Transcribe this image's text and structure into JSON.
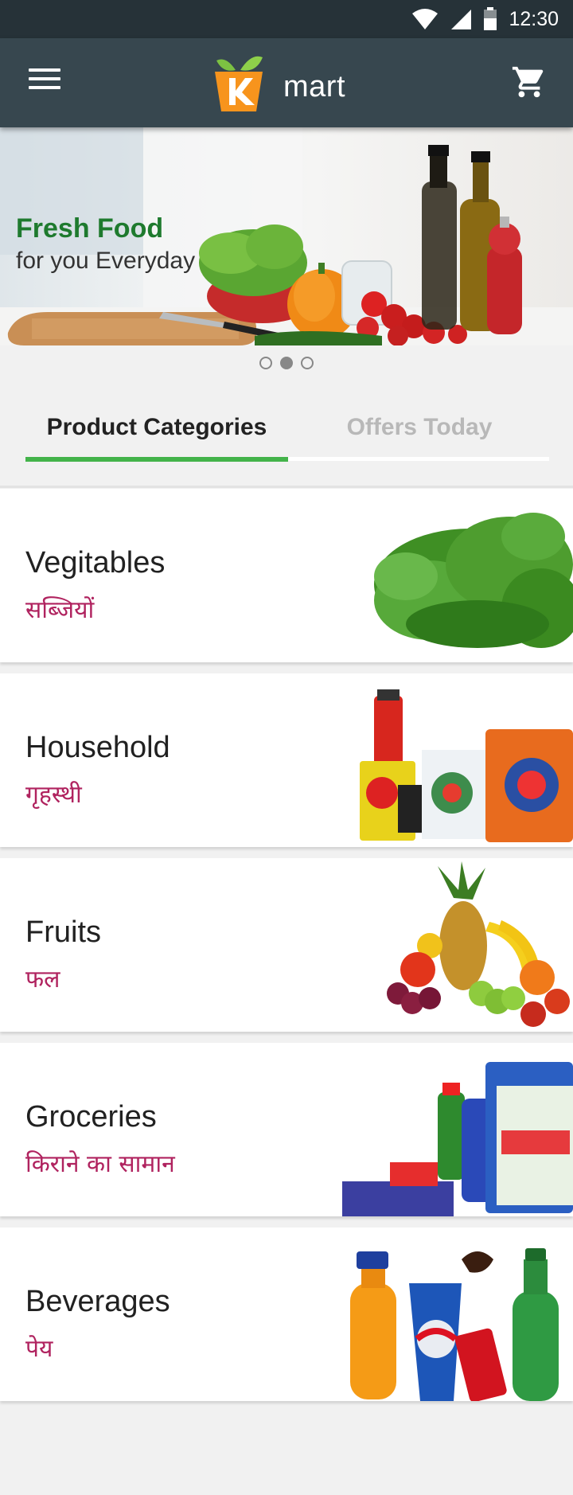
{
  "status_bar": {
    "time": "12:30",
    "icons": [
      "wifi-icon",
      "signal-icon",
      "battery-icon"
    ]
  },
  "app_bar": {
    "title": "mart",
    "menu_icon": "hamburger-menu-icon",
    "cart_icon": "shopping-cart-icon"
  },
  "banner": {
    "title": "Fresh Food",
    "subtitle": "for you Everyday",
    "pager": {
      "count": 3,
      "active_index": 1
    }
  },
  "tabs": [
    {
      "label": "Product Categories",
      "selected": true
    },
    {
      "label": "Offers Today",
      "selected": false
    }
  ],
  "categories": [
    {
      "name": "Vegitables",
      "name_hi": "सब्जियों",
      "image": "vegetables-image"
    },
    {
      "name": "Household",
      "name_hi": "गृहस्थी",
      "image": "household-products-image"
    },
    {
      "name": "Fruits",
      "name_hi": "फल",
      "image": "fruits-image"
    },
    {
      "name": "Groceries",
      "name_hi": "किराने का सामान",
      "image": "groceries-image"
    },
    {
      "name": "Beverages",
      "name_hi": "पेय",
      "image": "beverages-image"
    }
  ],
  "colors": {
    "status_bar": "#263238",
    "app_bar": "#37474f",
    "accent_green": "#43b34a",
    "banner_title": "#1e7a2e",
    "hindi_text": "#b0235f",
    "background": "#f1f1f1"
  }
}
